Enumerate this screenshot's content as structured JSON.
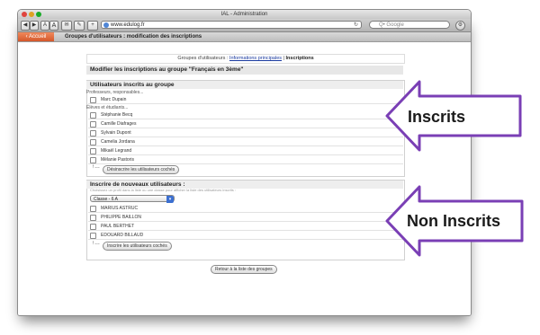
{
  "browser": {
    "title": "IAL - Administration",
    "url": "www.edulog.fr",
    "search_placeholder": "Q• Google",
    "nav_buttons": [
      "◀",
      "▶",
      "A",
      "A",
      "✉",
      "✎",
      "+"
    ]
  },
  "navbar": {
    "home_label": "‹ Accueil",
    "page_title": "Groupes d'utilisateurs : modification des inscriptions"
  },
  "breadcrumb": {
    "prefix": "Groupes d'utilisateurs : ",
    "link": "Informations principales",
    "separator": " | ",
    "current": "Inscriptions"
  },
  "main": {
    "heading": "Modifier les inscriptions au groupe \"Français en 3ème\"",
    "enrolled": {
      "title": "Utilisateurs inscrits au groupe",
      "teachers_label": "Professeurs, responsables...",
      "teachers": [
        "Marc Dupain"
      ],
      "students_label": "Élèves et étudiants...",
      "students": [
        "Stéphanie Becq",
        "Camille Diafrages",
        "Sylvain Dupont",
        "Camelia Jordana",
        "Mikaël Legrand",
        "Mélanie Pastoris"
      ],
      "action_button": "Désinscrire les utilisateurs cochés"
    },
    "new": {
      "title": "Inscrire de nouveaux utilisateurs :",
      "hint": "Choisissez un profil dans la liste ou une classe pour afficher la liste des utilisateurs inscrits :",
      "class_select": "Classe - 6 A",
      "users": [
        "MARIUS ASTRUC",
        "PHILIPPE BAILLON",
        "PAUL BERTHET",
        "EDOUARD BILLAUD"
      ],
      "action_button": "Inscrire les utilisateurs cochés"
    },
    "back_button": "Retour à la liste des groupes"
  },
  "callouts": {
    "enrolled_label": "Inscrits",
    "not_enrolled_label": "Non Inscrits"
  }
}
